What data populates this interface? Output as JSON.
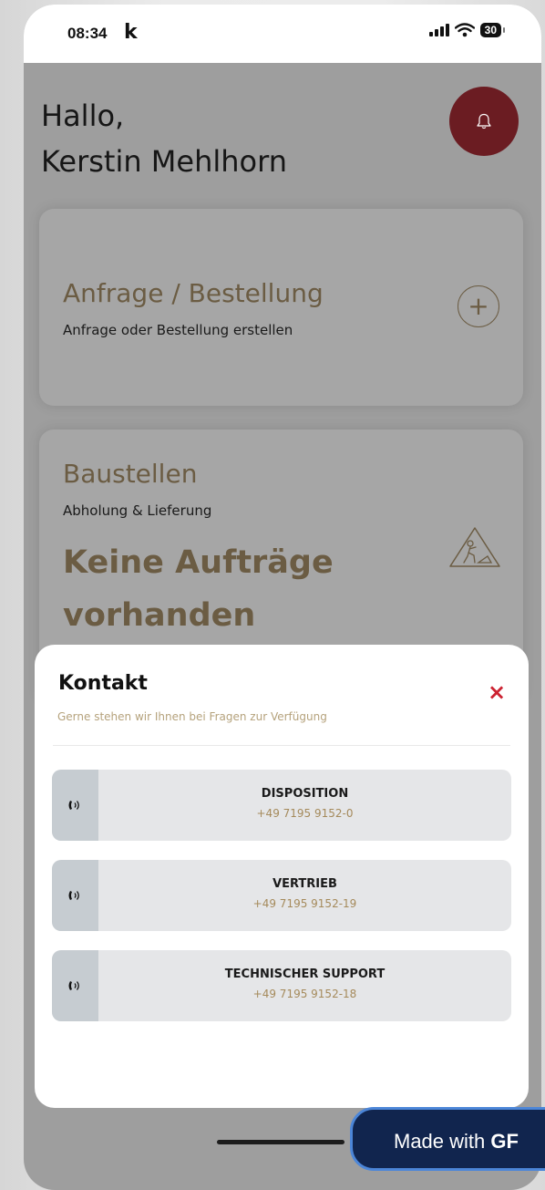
{
  "status_bar": {
    "time": "08:34",
    "carrier_mark": "k",
    "battery": "30"
  },
  "greeting": {
    "line1": "Hallo,",
    "line2": "Kerstin Mehlhorn"
  },
  "cards": {
    "order": {
      "title": "Anfrage / Bestellung",
      "subtitle": "Anfrage oder Bestellung erstellen"
    },
    "sites": {
      "title": "Baustellen",
      "subtitle": "Abholung & Lieferung",
      "empty_line1": "Keine Aufträge",
      "empty_line2": "vorhanden"
    }
  },
  "contact_sheet": {
    "title": "Kontakt",
    "subtitle": "Gerne stehen wir Ihnen bei Fragen zur Verfügung",
    "close_label": "×",
    "items": [
      {
        "name": "DISPOSITION",
        "phone": "+49 7195 9152-0"
      },
      {
        "name": "VERTRIEB",
        "phone": "+49 7195 9152-19"
      },
      {
        "name": "TECHNISCHER SUPPORT",
        "phone": "+49 7195 9152-18"
      }
    ]
  },
  "badge": {
    "prefix": "Made with",
    "brand": "GF"
  },
  "colors": {
    "accent": "#6b1c22",
    "brown": "#6b5c43",
    "close": "#cc2231",
    "phone_gold": "#a58a5b"
  },
  "icons": [
    "bell-icon",
    "plus-circle-icon",
    "construction-sign-icon",
    "phone-call-icon",
    "close-icon",
    "signal-icon",
    "wifi-icon"
  ]
}
